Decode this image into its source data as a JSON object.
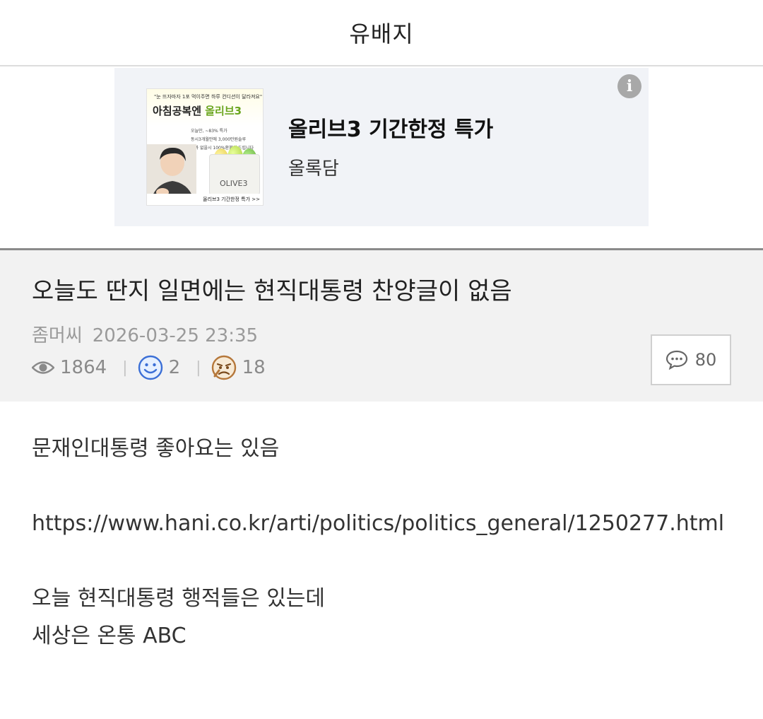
{
  "header": {
    "title": "유배지"
  },
  "ad": {
    "title": "올리브3 기간한정 특가",
    "advertiser": "올록담",
    "info_icon": "info-icon",
    "thumbnail": {
      "tagline": "\"눈 뜨자마자 1포 먹이주면 하루 컨디션이 달라져요\"",
      "headline_pre": "아침공복엔 ",
      "headline_brand": "올리브3",
      "lines": [
        "오늘만, ~83% 특가",
        "동시3개월만에 3,000만원솔루",
        "효과 없을시 100%환불해 드립니다"
      ],
      "product_label": "OLIVE3",
      "footer": "올리브3 기간한정 특가 >>"
    }
  },
  "post": {
    "title": "오늘도 딴지 일면에는 현직대통령 찬양글이 없음",
    "author": "좀머씨",
    "datetime": "2026-03-25 23:35",
    "views": "1864",
    "likes": "2",
    "dislikes": "18",
    "comments": "80"
  },
  "body": {
    "line1": "문재인대통령 좋아요는 있음",
    "url": "https://www.hani.co.kr/arti/politics/politics_general/1250277.html",
    "line3": "오늘 현직대통령 행적들은 있는데",
    "line4": "세상은 온통 ABC"
  },
  "colors": {
    "ad_background": "#f1f3f7",
    "post_header_background": "#f2f2f2",
    "smile_icon": "#3b6fd6",
    "dislike_icon": "#c88a3a"
  }
}
